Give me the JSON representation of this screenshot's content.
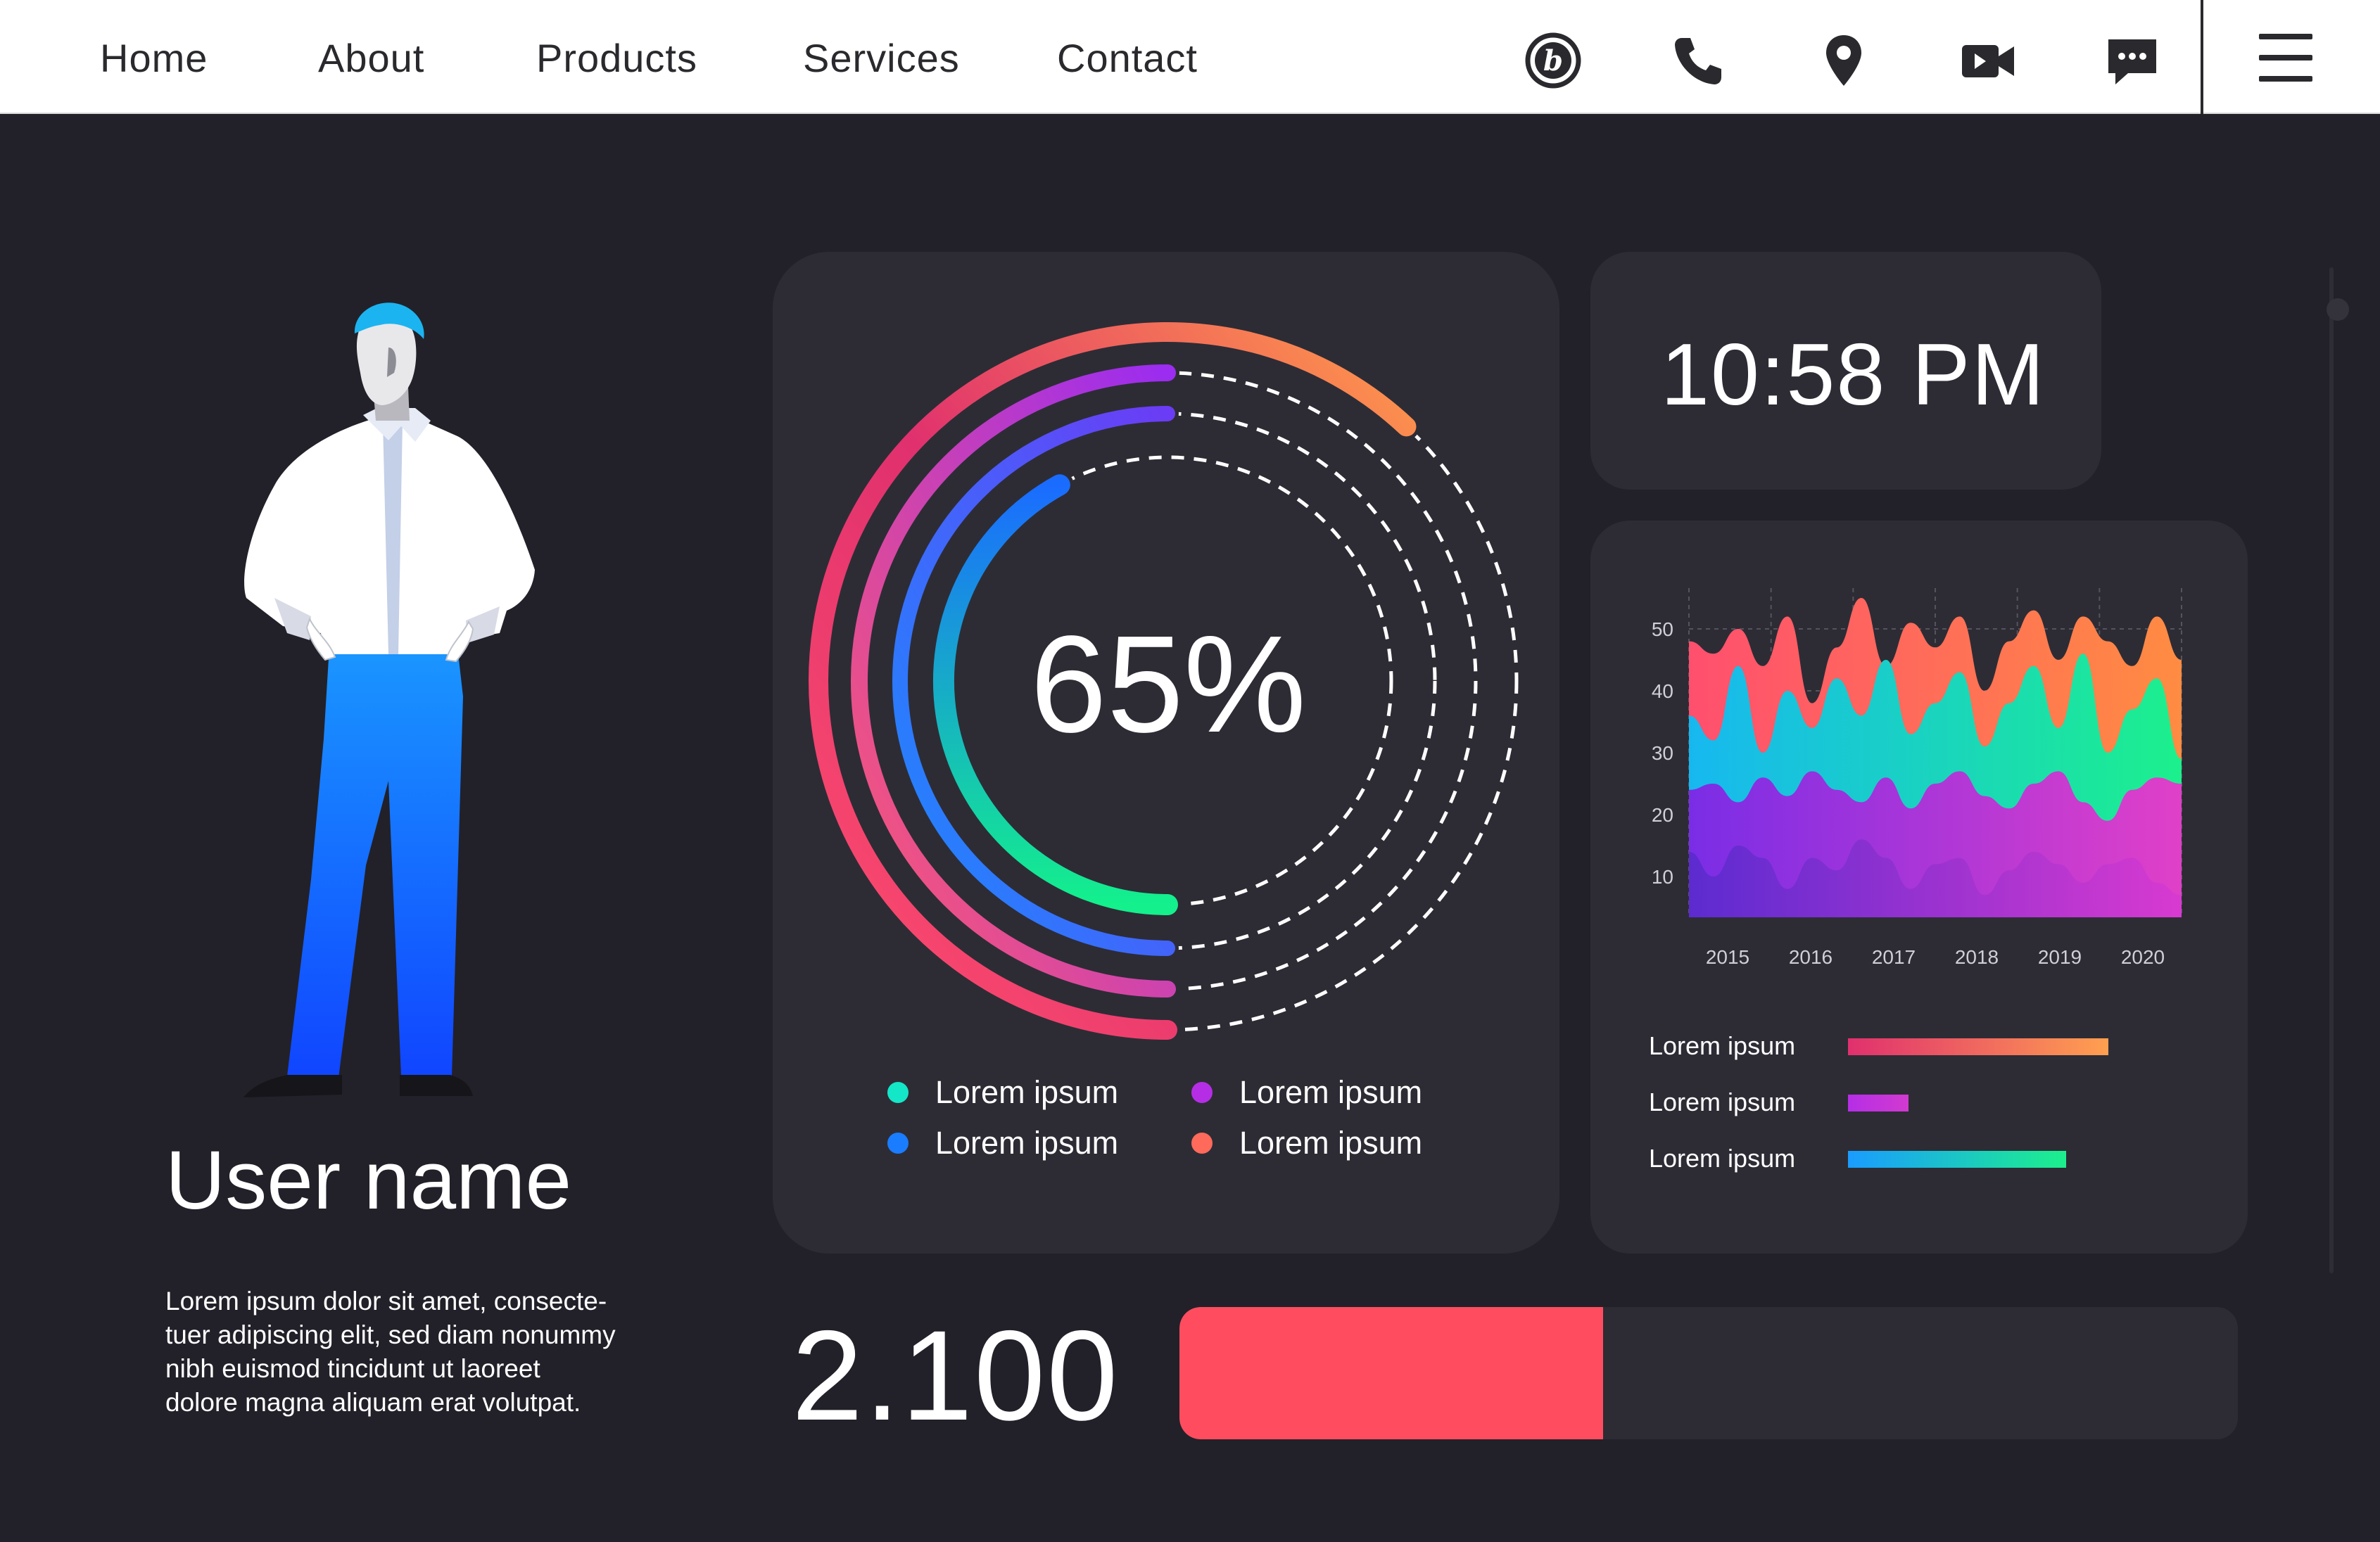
{
  "nav": {
    "links": [
      "Home",
      "About",
      "Products",
      "Services",
      "Contact"
    ],
    "icons": [
      "brand-b-icon",
      "phone-icon",
      "location-pin-icon",
      "video-camera-icon",
      "chat-icon",
      "menu-icon"
    ]
  },
  "profile": {
    "name": "User name",
    "description_lines": [
      "Lorem ipsum dolor sit amet, consecte-",
      "tuer adipiscing elit, sed diam nonummy",
      "nibh euismod tincidunt ut laoreet",
      "dolore magna aliquam erat volutpat."
    ]
  },
  "donut": {
    "value_label": "65%",
    "rings": [
      {
        "fraction": 0.62,
        "colors": [
          "#ff4f6e",
          "#ff9a4a"
        ]
      },
      {
        "fraction": 0.5,
        "colors": [
          "#ff5a6e",
          "#9b2cf0"
        ]
      },
      {
        "fraction": 0.5,
        "colors": [
          "#1a8cff",
          "#6b3cf5"
        ]
      },
      {
        "fraction": 0.42,
        "colors": [
          "#13f08c",
          "#1a6cff"
        ]
      }
    ],
    "legend": [
      {
        "label": "Lorem ipsum",
        "color": "#14e6c8"
      },
      {
        "label": "Lorem ipsum",
        "color": "#b52ee6"
      },
      {
        "label": "Lorem ipsum",
        "color": "#1a7cff"
      },
      {
        "label": "Lorem ipsum",
        "color": "#ff6a5a"
      }
    ]
  },
  "clock": {
    "time": "10:58 PM"
  },
  "chart_data": {
    "type": "area",
    "x": [
      "2015",
      "2016",
      "2017",
      "2018",
      "2019",
      "2020"
    ],
    "ylim": [
      5,
      55
    ],
    "yticks": [
      10,
      20,
      30,
      40,
      50
    ],
    "grid": true,
    "series": [
      {
        "colors": [
          "#ff4f6e",
          "#ff8c42"
        ],
        "values": [
          48,
          46,
          50,
          44,
          52,
          38,
          47,
          55,
          44,
          51,
          47,
          52,
          40,
          48,
          53,
          45,
          52,
          48,
          44,
          52,
          45
        ]
      },
      {
        "colors": [
          "#17b8f0",
          "#1cf08c"
        ],
        "values": [
          36,
          32,
          44,
          30,
          40,
          34,
          42,
          36,
          45,
          33,
          38,
          43,
          31,
          38,
          44,
          34,
          46,
          30,
          37,
          42,
          29
        ]
      },
      {
        "colors": [
          "#7a2de6",
          "#e040c8"
        ],
        "values": [
          24,
          25,
          22,
          26,
          23,
          27,
          24,
          22,
          26,
          21,
          25,
          27,
          23,
          21,
          25,
          27,
          22,
          19,
          24,
          26,
          25
        ]
      },
      {
        "colors": [
          "#5c2bd0",
          "#d83ad0"
        ],
        "values": [
          14,
          10,
          15,
          13,
          8,
          13,
          11,
          16,
          13,
          8,
          12,
          13,
          7,
          11,
          14,
          12,
          9,
          12,
          13,
          9,
          7
        ]
      }
    ]
  },
  "bar_legend": [
    {
      "label": "Lorem ipsum",
      "fraction": 0.43,
      "colors": [
        "#e0306e",
        "#ffa050"
      ]
    },
    {
      "label": "Lorem ipsum",
      "fraction": 0.1,
      "colors": [
        "#b52ee6",
        "#d23ad0"
      ]
    },
    {
      "label": "Lorem ipsum",
      "fraction": 0.36,
      "colors": [
        "#1a9cff",
        "#1cf08c"
      ]
    }
  ],
  "summary": {
    "value": "2.100",
    "progress": 0.4,
    "progress_color": "#ff4d5f"
  }
}
